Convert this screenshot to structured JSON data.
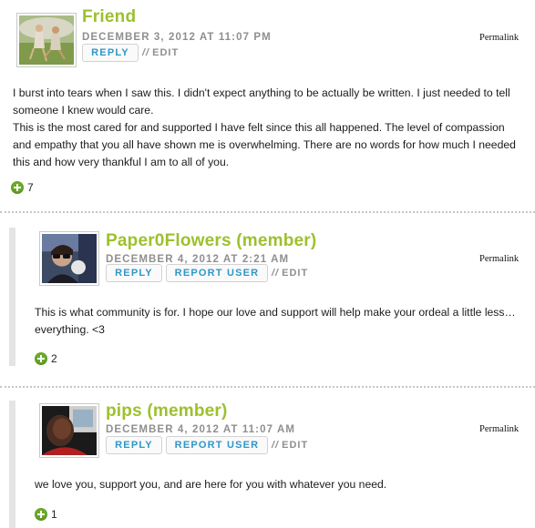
{
  "comments": [
    {
      "author": "Friend",
      "date": "DECEMBER 3, 2012 AT 11:07 PM",
      "permalink": "Permalink",
      "reply_label": "REPLY",
      "report_label": "",
      "edit_label": "EDIT",
      "paragraphs": [
        "I burst into tears when I saw this. I didn't expect anything to be actually be written. I just needed to tell someone I knew would care.",
        "This is the most cared for and supported I have felt since this all happened. The level of compassion and empathy that you all have shown me is overwhelming. There are no words for how much I needed this and how very thankful I am to all of you."
      ],
      "votes": "7"
    },
    {
      "author": "Paper0Flowers (member)",
      "date": "DECEMBER 4, 2012 AT 2:21 AM",
      "permalink": "Permalink",
      "reply_label": "REPLY",
      "report_label": "REPORT USER",
      "edit_label": "EDIT",
      "paragraphs": [
        "This is what community is for. I hope our love and support will help make your ordeal a little less… everything. <3"
      ],
      "votes": "2"
    },
    {
      "author": "pips (member)",
      "date": "DECEMBER 4, 2012 AT 11:07 AM",
      "permalink": "Permalink",
      "reply_label": "REPLY",
      "report_label": "REPORT USER",
      "edit_label": "EDIT",
      "paragraphs": [
        "we love you, support you, and are here for you with whatever you need."
      ],
      "votes": "1"
    }
  ],
  "separator": "//",
  "icons": {
    "vote": "plus-circle-icon",
    "avatar": "user-avatar"
  },
  "colors": {
    "author": "#9dc02e",
    "button_text": "#2f97c7",
    "meta": "#8f8f8f",
    "vote": "#6aa92a"
  }
}
